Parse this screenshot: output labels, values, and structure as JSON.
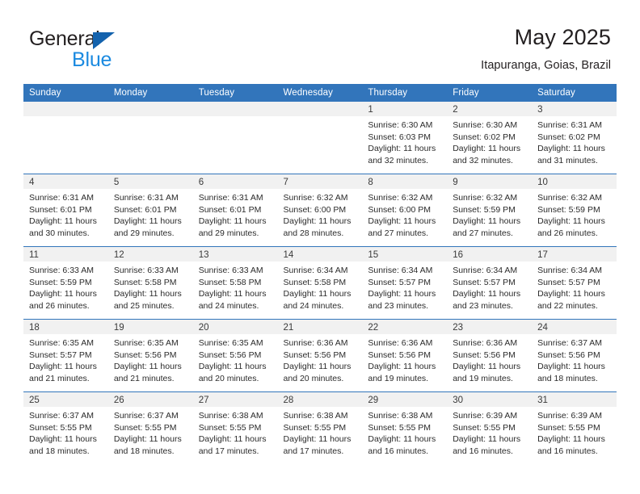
{
  "brand": {
    "name_top": "General",
    "name_bottom": "Blue",
    "accent_color": "#1362ad",
    "accent_light": "#1b8ae0"
  },
  "header": {
    "title": "May 2025",
    "subtitle": "Itapuranga, Goias, Brazil"
  },
  "theme": {
    "header_bg": "#3275bb",
    "cell_shade": "#f1f1f1",
    "text": "#2b2b2b"
  },
  "calendar": {
    "weekday_headers": [
      "Sunday",
      "Monday",
      "Tuesday",
      "Wednesday",
      "Thursday",
      "Friday",
      "Saturday"
    ],
    "weeks": [
      [
        {
          "day": "",
          "empty": true
        },
        {
          "day": "",
          "empty": true
        },
        {
          "day": "",
          "empty": true
        },
        {
          "day": "",
          "empty": true
        },
        {
          "day": "1",
          "sunrise": "Sunrise: 6:30 AM",
          "sunset": "Sunset: 6:03 PM",
          "daylight_1": "Daylight: 11 hours",
          "daylight_2": "and 32 minutes."
        },
        {
          "day": "2",
          "sunrise": "Sunrise: 6:30 AM",
          "sunset": "Sunset: 6:02 PM",
          "daylight_1": "Daylight: 11 hours",
          "daylight_2": "and 32 minutes."
        },
        {
          "day": "3",
          "sunrise": "Sunrise: 6:31 AM",
          "sunset": "Sunset: 6:02 PM",
          "daylight_1": "Daylight: 11 hours",
          "daylight_2": "and 31 minutes."
        }
      ],
      [
        {
          "day": "4",
          "sunrise": "Sunrise: 6:31 AM",
          "sunset": "Sunset: 6:01 PM",
          "daylight_1": "Daylight: 11 hours",
          "daylight_2": "and 30 minutes."
        },
        {
          "day": "5",
          "sunrise": "Sunrise: 6:31 AM",
          "sunset": "Sunset: 6:01 PM",
          "daylight_1": "Daylight: 11 hours",
          "daylight_2": "and 29 minutes."
        },
        {
          "day": "6",
          "sunrise": "Sunrise: 6:31 AM",
          "sunset": "Sunset: 6:01 PM",
          "daylight_1": "Daylight: 11 hours",
          "daylight_2": "and 29 minutes."
        },
        {
          "day": "7",
          "sunrise": "Sunrise: 6:32 AM",
          "sunset": "Sunset: 6:00 PM",
          "daylight_1": "Daylight: 11 hours",
          "daylight_2": "and 28 minutes."
        },
        {
          "day": "8",
          "sunrise": "Sunrise: 6:32 AM",
          "sunset": "Sunset: 6:00 PM",
          "daylight_1": "Daylight: 11 hours",
          "daylight_2": "and 27 minutes."
        },
        {
          "day": "9",
          "sunrise": "Sunrise: 6:32 AM",
          "sunset": "Sunset: 5:59 PM",
          "daylight_1": "Daylight: 11 hours",
          "daylight_2": "and 27 minutes."
        },
        {
          "day": "10",
          "sunrise": "Sunrise: 6:32 AM",
          "sunset": "Sunset: 5:59 PM",
          "daylight_1": "Daylight: 11 hours",
          "daylight_2": "and 26 minutes."
        }
      ],
      [
        {
          "day": "11",
          "sunrise": "Sunrise: 6:33 AM",
          "sunset": "Sunset: 5:59 PM",
          "daylight_1": "Daylight: 11 hours",
          "daylight_2": "and 26 minutes."
        },
        {
          "day": "12",
          "sunrise": "Sunrise: 6:33 AM",
          "sunset": "Sunset: 5:58 PM",
          "daylight_1": "Daylight: 11 hours",
          "daylight_2": "and 25 minutes."
        },
        {
          "day": "13",
          "sunrise": "Sunrise: 6:33 AM",
          "sunset": "Sunset: 5:58 PM",
          "daylight_1": "Daylight: 11 hours",
          "daylight_2": "and 24 minutes."
        },
        {
          "day": "14",
          "sunrise": "Sunrise: 6:34 AM",
          "sunset": "Sunset: 5:58 PM",
          "daylight_1": "Daylight: 11 hours",
          "daylight_2": "and 24 minutes."
        },
        {
          "day": "15",
          "sunrise": "Sunrise: 6:34 AM",
          "sunset": "Sunset: 5:57 PM",
          "daylight_1": "Daylight: 11 hours",
          "daylight_2": "and 23 minutes."
        },
        {
          "day": "16",
          "sunrise": "Sunrise: 6:34 AM",
          "sunset": "Sunset: 5:57 PM",
          "daylight_1": "Daylight: 11 hours",
          "daylight_2": "and 23 minutes."
        },
        {
          "day": "17",
          "sunrise": "Sunrise: 6:34 AM",
          "sunset": "Sunset: 5:57 PM",
          "daylight_1": "Daylight: 11 hours",
          "daylight_2": "and 22 minutes."
        }
      ],
      [
        {
          "day": "18",
          "sunrise": "Sunrise: 6:35 AM",
          "sunset": "Sunset: 5:57 PM",
          "daylight_1": "Daylight: 11 hours",
          "daylight_2": "and 21 minutes."
        },
        {
          "day": "19",
          "sunrise": "Sunrise: 6:35 AM",
          "sunset": "Sunset: 5:56 PM",
          "daylight_1": "Daylight: 11 hours",
          "daylight_2": "and 21 minutes."
        },
        {
          "day": "20",
          "sunrise": "Sunrise: 6:35 AM",
          "sunset": "Sunset: 5:56 PM",
          "daylight_1": "Daylight: 11 hours",
          "daylight_2": "and 20 minutes."
        },
        {
          "day": "21",
          "sunrise": "Sunrise: 6:36 AM",
          "sunset": "Sunset: 5:56 PM",
          "daylight_1": "Daylight: 11 hours",
          "daylight_2": "and 20 minutes."
        },
        {
          "day": "22",
          "sunrise": "Sunrise: 6:36 AM",
          "sunset": "Sunset: 5:56 PM",
          "daylight_1": "Daylight: 11 hours",
          "daylight_2": "and 19 minutes."
        },
        {
          "day": "23",
          "sunrise": "Sunrise: 6:36 AM",
          "sunset": "Sunset: 5:56 PM",
          "daylight_1": "Daylight: 11 hours",
          "daylight_2": "and 19 minutes."
        },
        {
          "day": "24",
          "sunrise": "Sunrise: 6:37 AM",
          "sunset": "Sunset: 5:56 PM",
          "daylight_1": "Daylight: 11 hours",
          "daylight_2": "and 18 minutes."
        }
      ],
      [
        {
          "day": "25",
          "sunrise": "Sunrise: 6:37 AM",
          "sunset": "Sunset: 5:55 PM",
          "daylight_1": "Daylight: 11 hours",
          "daylight_2": "and 18 minutes."
        },
        {
          "day": "26",
          "sunrise": "Sunrise: 6:37 AM",
          "sunset": "Sunset: 5:55 PM",
          "daylight_1": "Daylight: 11 hours",
          "daylight_2": "and 18 minutes."
        },
        {
          "day": "27",
          "sunrise": "Sunrise: 6:38 AM",
          "sunset": "Sunset: 5:55 PM",
          "daylight_1": "Daylight: 11 hours",
          "daylight_2": "and 17 minutes."
        },
        {
          "day": "28",
          "sunrise": "Sunrise: 6:38 AM",
          "sunset": "Sunset: 5:55 PM",
          "daylight_1": "Daylight: 11 hours",
          "daylight_2": "and 17 minutes."
        },
        {
          "day": "29",
          "sunrise": "Sunrise: 6:38 AM",
          "sunset": "Sunset: 5:55 PM",
          "daylight_1": "Daylight: 11 hours",
          "daylight_2": "and 16 minutes."
        },
        {
          "day": "30",
          "sunrise": "Sunrise: 6:39 AM",
          "sunset": "Sunset: 5:55 PM",
          "daylight_1": "Daylight: 11 hours",
          "daylight_2": "and 16 minutes."
        },
        {
          "day": "31",
          "sunrise": "Sunrise: 6:39 AM",
          "sunset": "Sunset: 5:55 PM",
          "daylight_1": "Daylight: 11 hours",
          "daylight_2": "and 16 minutes."
        }
      ]
    ]
  }
}
